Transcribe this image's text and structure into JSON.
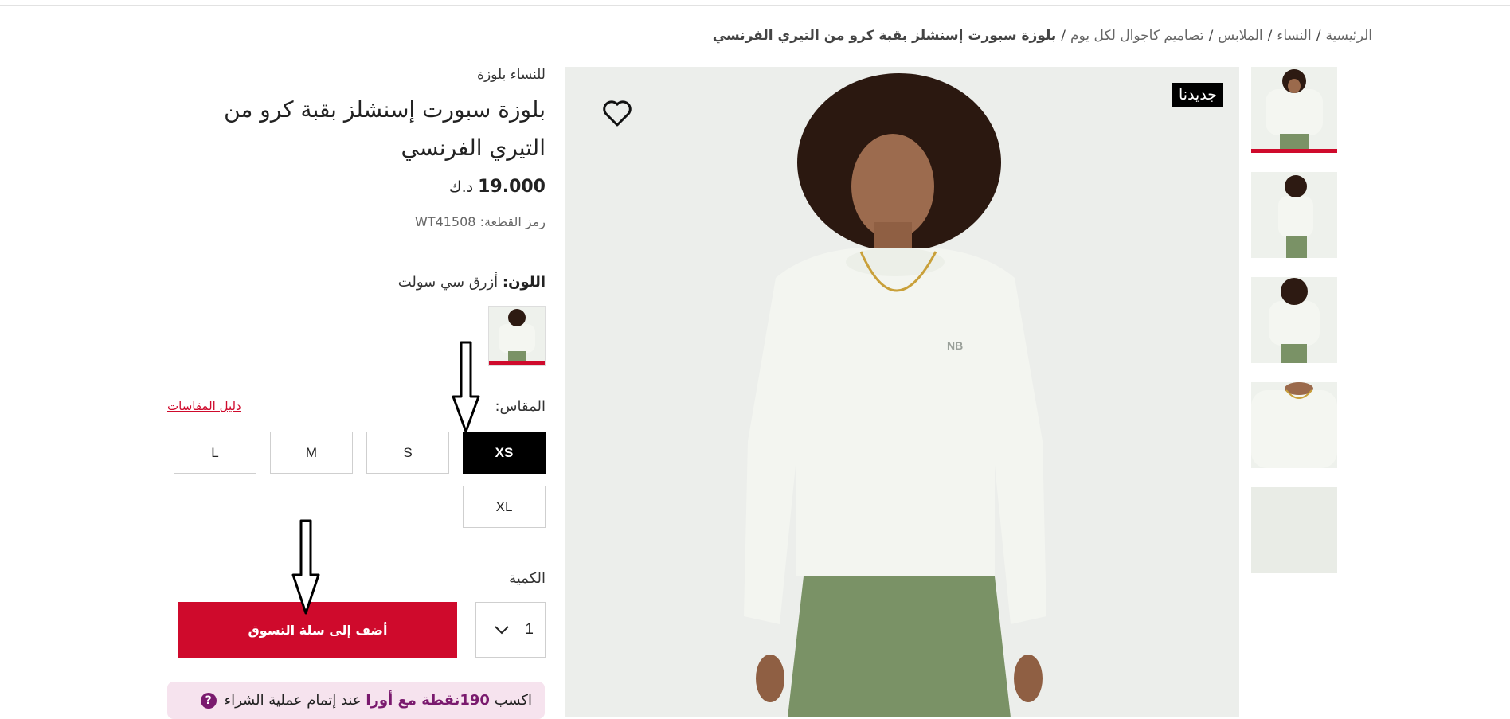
{
  "breadcrumb": {
    "items": [
      "الرئيسية",
      "النساء",
      "الملابس",
      "تصاميم كاجوال لكل يوم"
    ],
    "separator": "/",
    "current": "بلوزة سبورت إسنشلز بقبة كرو من التيري الفرنسي"
  },
  "gallery": {
    "thumbnails": [
      {
        "name": "thumb-front",
        "active": true
      },
      {
        "name": "thumb-side",
        "active": false
      },
      {
        "name": "thumb-back",
        "active": false
      },
      {
        "name": "thumb-detail",
        "active": false
      },
      {
        "name": "thumb-fabric",
        "active": false
      }
    ],
    "badge": "جديدنا",
    "favorite_icon": "heart-icon"
  },
  "product": {
    "category": "للنساء بلوزة",
    "title": "بلوزة سبورت إسنشلز بقبة كرو من التيري الفرنسي",
    "price": "19.000",
    "currency": "د.ك",
    "sku_label": "رمز القطعة:",
    "sku": "WT41508",
    "color_label": "اللون:",
    "color_value": "أزرق سي سولت"
  },
  "sizes": {
    "label": "المقاس:",
    "guide_label": "دليل المقاسات",
    "options": [
      "XS",
      "S",
      "M",
      "L",
      "XL"
    ],
    "selected": "XS"
  },
  "quantity": {
    "label": "الكمية",
    "value": "1"
  },
  "cart": {
    "add_label": "أضف إلى سلة التسوق"
  },
  "loyalty": {
    "prefix": "اكسب",
    "highlight": "190نقطة مع أورا",
    "suffix": "عند إتمام عملية الشراء",
    "info_icon": "?"
  },
  "colors": {
    "accent": "#cf0a2c",
    "loyalty_bg": "#f6e3ee",
    "loyalty_text": "#7a1a6e"
  }
}
